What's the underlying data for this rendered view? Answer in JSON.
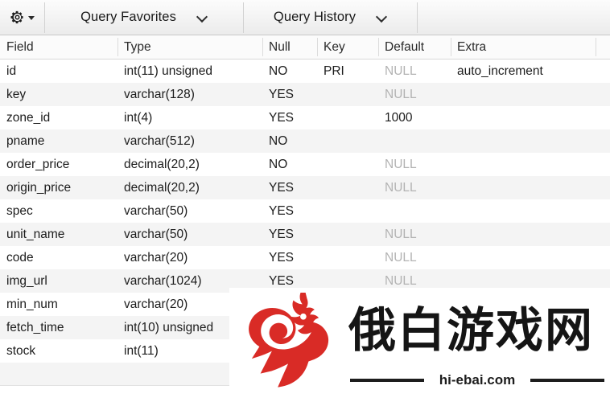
{
  "toolbar": {
    "gear_icon": "gear-icon",
    "gear_caret_icon": "caret-down-icon",
    "menus": [
      {
        "label": "Query Favorites",
        "chevron_icon": "chevron-down-icon"
      },
      {
        "label": "Query History",
        "chevron_icon": "chevron-down-icon"
      }
    ]
  },
  "table": {
    "columns": [
      {
        "key": "field",
        "label": "Field"
      },
      {
        "key": "type",
        "label": "Type"
      },
      {
        "key": "null",
        "label": "Null"
      },
      {
        "key": "key",
        "label": "Key"
      },
      {
        "key": "default",
        "label": "Default"
      },
      {
        "key": "extra",
        "label": "Extra"
      }
    ],
    "rows": [
      {
        "field": "id",
        "type": "int(11) unsigned",
        "null": "NO",
        "key": "PRI",
        "default": "NULL",
        "default_is_null": true,
        "extra": "auto_increment"
      },
      {
        "field": "key",
        "type": "varchar(128)",
        "null": "YES",
        "key": "",
        "default": "NULL",
        "default_is_null": true,
        "extra": ""
      },
      {
        "field": "zone_id",
        "type": "int(4)",
        "null": "YES",
        "key": "",
        "default": "1000",
        "default_is_null": false,
        "extra": ""
      },
      {
        "field": "pname",
        "type": "varchar(512)",
        "null": "NO",
        "key": "",
        "default": "",
        "default_is_null": false,
        "extra": ""
      },
      {
        "field": "order_price",
        "type": "decimal(20,2)",
        "null": "NO",
        "key": "",
        "default": "NULL",
        "default_is_null": true,
        "extra": ""
      },
      {
        "field": "origin_price",
        "type": "decimal(20,2)",
        "null": "YES",
        "key": "",
        "default": "NULL",
        "default_is_null": true,
        "extra": ""
      },
      {
        "field": "spec",
        "type": "varchar(50)",
        "null": "YES",
        "key": "",
        "default": "",
        "default_is_null": false,
        "extra": ""
      },
      {
        "field": "unit_name",
        "type": "varchar(50)",
        "null": "YES",
        "key": "",
        "default": "NULL",
        "default_is_null": true,
        "extra": ""
      },
      {
        "field": "code",
        "type": "varchar(20)",
        "null": "YES",
        "key": "",
        "default": "NULL",
        "default_is_null": true,
        "extra": ""
      },
      {
        "field": "img_url",
        "type": "varchar(1024)",
        "null": "YES",
        "key": "",
        "default": "NULL",
        "default_is_null": true,
        "extra": ""
      },
      {
        "field": "min_num",
        "type": "varchar(20)",
        "null": "",
        "key": "",
        "default": "",
        "default_is_null": false,
        "extra": ""
      },
      {
        "field": "fetch_time",
        "type": "int(10) unsigned",
        "null": "",
        "key": "",
        "default": "",
        "default_is_null": false,
        "extra": ""
      },
      {
        "field": "stock",
        "type": "int(11)",
        "null": "",
        "key": "",
        "default": "",
        "default_is_null": false,
        "extra": ""
      },
      {
        "field": "",
        "type": "",
        "null": "",
        "key": "",
        "default": "",
        "default_is_null": false,
        "extra": ""
      }
    ]
  },
  "watermark": {
    "logo_icon": "rooster-logo-icon",
    "brand_cn": "俄白游戏网",
    "domain": "hi-ebai.com",
    "logo_color": "#d92b26",
    "text_color": "#151515"
  }
}
